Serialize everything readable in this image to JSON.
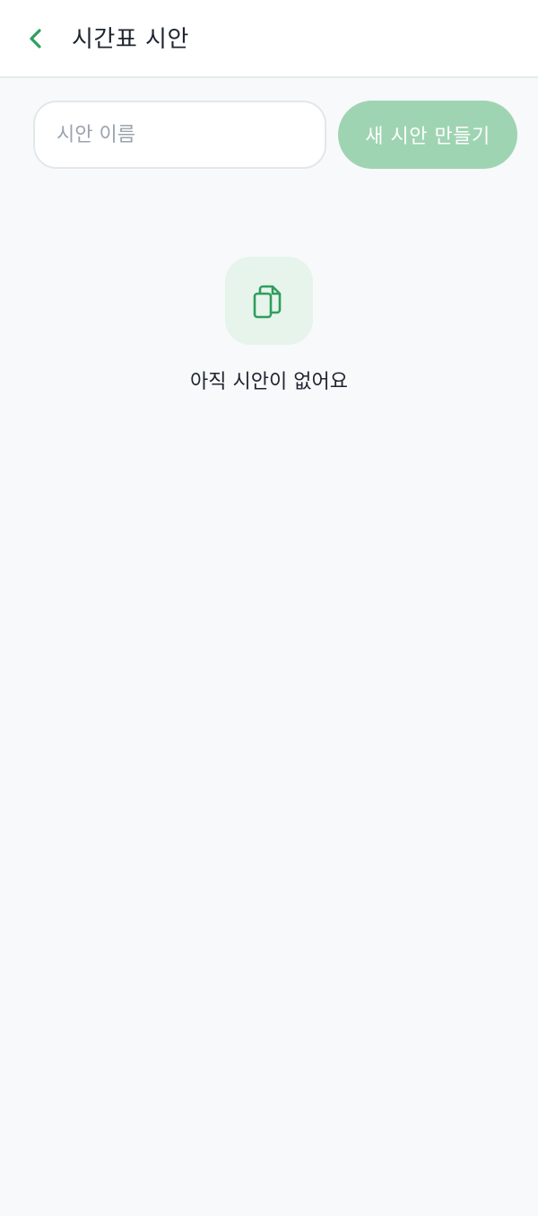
{
  "header": {
    "title": "시간표 시안",
    "back_icon": "chevron-left-icon"
  },
  "form": {
    "name_placeholder": "시안 이름",
    "name_value": "",
    "create_label": "새 시안 만들기"
  },
  "empty_state": {
    "icon": "documents-icon",
    "message": "아직 시안이 없어요"
  },
  "colors": {
    "accent": "#2e9e5e",
    "button_disabled": "#9fd4b2",
    "icon_bg": "#e6f4eb",
    "background": "#f7f9fa"
  }
}
